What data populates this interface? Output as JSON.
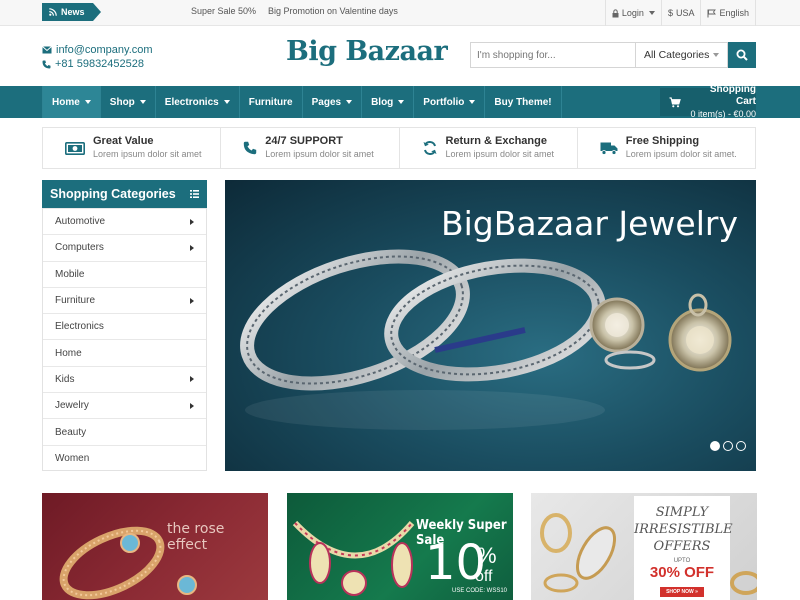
{
  "topbar": {
    "news_label": "News",
    "ticker": [
      "Super Sale 50%",
      "Big Promotion on Valentine days"
    ],
    "login_label": "Login",
    "currency_label": "USA",
    "language_label": "English"
  },
  "header": {
    "email": "info@company.com",
    "phone": "+81 59832452528",
    "logo": "Big Bazaar",
    "search_placeholder": "I'm shopping for...",
    "search_category": "All Categories"
  },
  "nav": {
    "items": [
      {
        "label": "Home",
        "caret": true,
        "active": true
      },
      {
        "label": "Shop",
        "caret": true
      },
      {
        "label": "Electronics",
        "caret": true
      },
      {
        "label": "Furniture",
        "caret": false
      },
      {
        "label": "Pages",
        "caret": true
      },
      {
        "label": "Blog",
        "caret": true
      },
      {
        "label": "Portfolio",
        "caret": true
      },
      {
        "label": "Buy Theme!",
        "caret": false
      }
    ]
  },
  "cart": {
    "title": "Shopping Cart",
    "summary": "0 item(s) - €0.00"
  },
  "features": [
    {
      "icon": "money-icon",
      "title": "Great Value",
      "desc": "Lorem ipsum dolor sit amet"
    },
    {
      "icon": "phone-icon",
      "title": "24/7 SUPPORT",
      "desc": "Lorem ipsum dolor sit amet"
    },
    {
      "icon": "refresh-icon",
      "title": "Return & Exchange",
      "desc": "Lorem ipsum dolor sit amet"
    },
    {
      "icon": "truck-icon",
      "title": "Free Shipping",
      "desc": "Lorem ipsum dolor sit amet."
    }
  ],
  "sidebar": {
    "title": "Shopping Categories",
    "items": [
      {
        "label": "Automotive",
        "sub": true
      },
      {
        "label": "Computers",
        "sub": true
      },
      {
        "label": "Mobile",
        "sub": false
      },
      {
        "label": "Furniture",
        "sub": true
      },
      {
        "label": "Electronics",
        "sub": false
      },
      {
        "label": "Home",
        "sub": false
      },
      {
        "label": "Kids",
        "sub": true
      },
      {
        "label": "Jewelry",
        "sub": true
      },
      {
        "label": "Beauty",
        "sub": false
      },
      {
        "label": "Women",
        "sub": false
      }
    ]
  },
  "hero": {
    "title": "BigBazaar Jewelry",
    "slide_count": 3,
    "active_slide": 1
  },
  "banners": {
    "rose": {
      "text": "the rose effect"
    },
    "weekly": {
      "title": "Weekly Super Sale",
      "percent": "10",
      "percent_sign": "%",
      "off": "off",
      "code": "USE CODE: WSS10"
    },
    "offers": {
      "title_lines": [
        "SIMPLY",
        "IRRESISTIBLE",
        "OFFERS"
      ],
      "upto": "UPTO",
      "off": "30% OFF",
      "button": "SHOP NOW »"
    }
  },
  "colors": {
    "brand": "#1c6e7d",
    "sale_red": "#d2312c"
  }
}
